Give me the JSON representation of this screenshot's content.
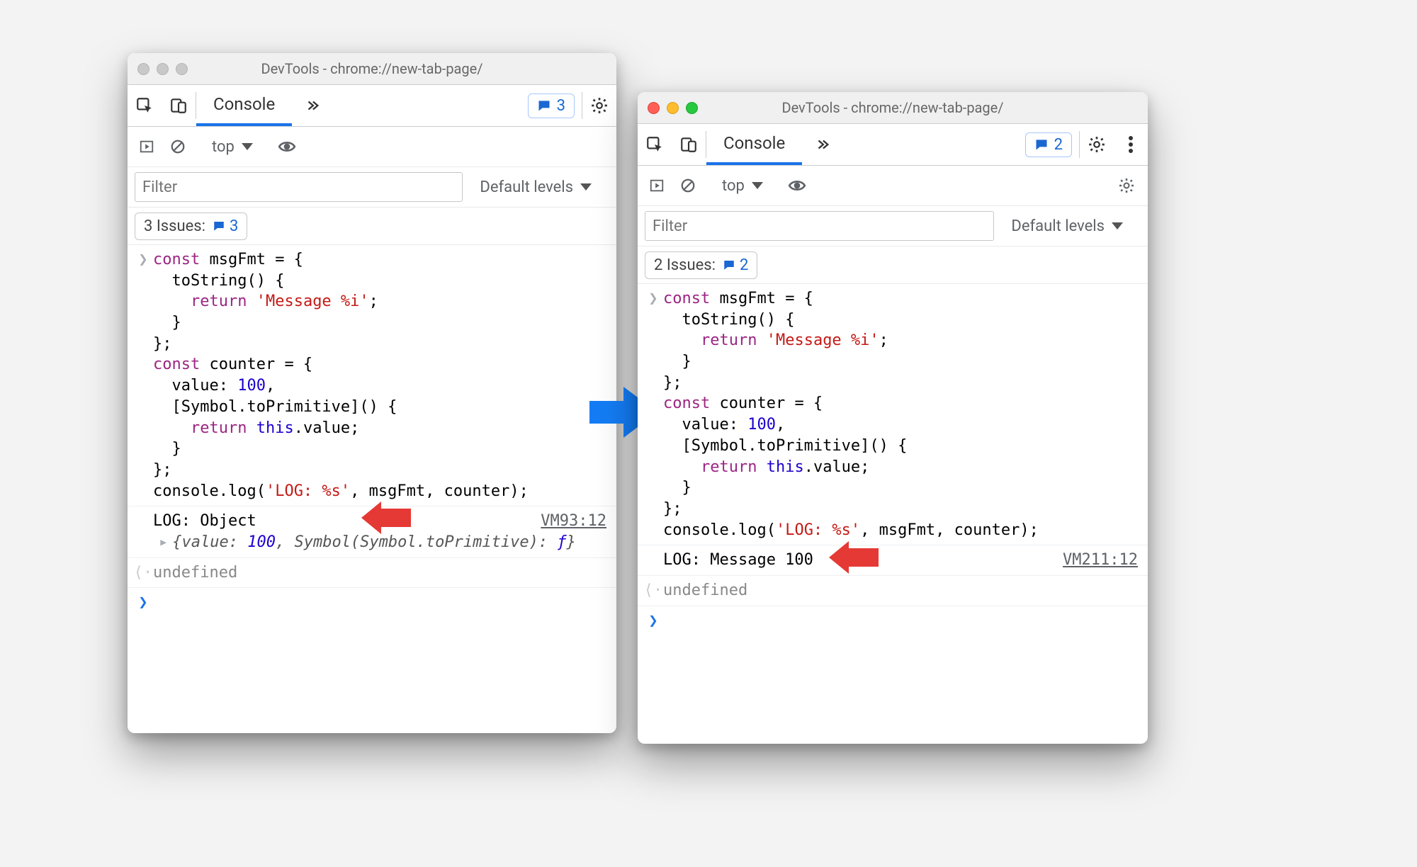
{
  "left": {
    "window_title": "DevTools - chrome://new-tab-page/",
    "console_tab": "Console",
    "badge_count": "3",
    "context": "top",
    "filter_placeholder": "Filter",
    "levels_label": "Default levels",
    "issues_label": "3 Issues:",
    "issues_count": "3",
    "vm_link": "VM93:12",
    "log_line": "LOG: Object",
    "obj_preview": "{value: 100, Symbol(Symbol.toPrimitive): ƒ}",
    "undefined_label": "undefined",
    "code": {
      "l1_const": "const",
      "l1_rest": " msgFmt = {",
      "l2": "  toString() {",
      "l3_return": "return",
      "l3_str": "'Message %i'",
      "l3_semicolon": ";",
      "l4": "  }",
      "l5": "};",
      "l6_const": "const",
      "l6_rest": " counter = {",
      "l7_a": "  value: ",
      "l7_num": "100",
      "l7_b": ",",
      "l8": "  [Symbol.toPrimitive]() {",
      "l9_return": "return",
      "l9_this": "this",
      "l9_rest": ".value;",
      "l10": "  }",
      "l11": "};",
      "l12_a": "console.log(",
      "l12_str": "'LOG: %s'",
      "l12_b": ", msgFmt, counter);"
    }
  },
  "right": {
    "window_title": "DevTools - chrome://new-tab-page/",
    "console_tab": "Console",
    "badge_count": "2",
    "context": "top",
    "filter_placeholder": "Filter",
    "levels_label": "Default levels",
    "issues_label": "2 Issues:",
    "issues_count": "2",
    "vm_link": "VM211:12",
    "log_line": "LOG: Message 100",
    "undefined_label": "undefined"
  }
}
